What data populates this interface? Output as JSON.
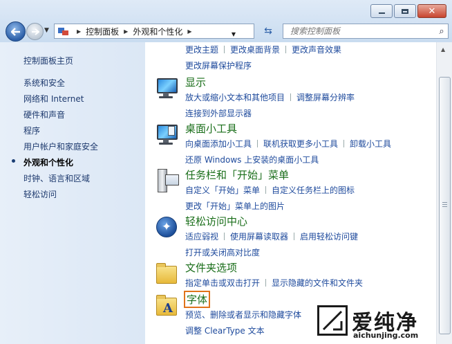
{
  "nav": {
    "breadcrumb": [
      "控制面板",
      "外观和个性化"
    ],
    "search_placeholder": "搜索控制面板"
  },
  "sidebar": {
    "home": "控制面板主页",
    "items": [
      {
        "label": "系统和安全"
      },
      {
        "label": "网络和 Internet"
      },
      {
        "label": "硬件和声音"
      },
      {
        "label": "程序"
      },
      {
        "label": "用户帐户和家庭安全"
      },
      {
        "label": "外观和个性化",
        "active": true
      },
      {
        "label": "时钟、语言和区域"
      },
      {
        "label": "轻松访问"
      }
    ]
  },
  "personalization_partial": {
    "links_row1": [
      "更改主题",
      "更改桌面背景",
      "更改声音效果"
    ],
    "links_row2": [
      "更改屏幕保护程序"
    ]
  },
  "categories": [
    {
      "title": "显示",
      "icon": "display-monitor-icon",
      "rows": [
        [
          "放大或缩小文本和其他项目",
          "调整屏幕分辨率"
        ],
        [
          "连接到外部显示器"
        ]
      ]
    },
    {
      "title": "桌面小工具",
      "icon": "gadgets-icon",
      "rows": [
        [
          "向桌面添加小工具",
          "联机获取更多小工具",
          "卸载小工具"
        ],
        [
          "还原 Windows 上安装的桌面小工具"
        ]
      ]
    },
    {
      "title": "任务栏和「开始」菜单",
      "icon": "taskbar-icon",
      "rows": [
        [
          "自定义「开始」菜单",
          "自定义任务栏上的图标"
        ],
        [
          "更改「开始」菜单上的图片"
        ]
      ]
    },
    {
      "title": "轻松访问中心",
      "icon": "ease-of-access-icon",
      "rows": [
        [
          "适应弱视",
          "使用屏幕读取器",
          "启用轻松访问键"
        ],
        [
          "打开或关闭高对比度"
        ]
      ]
    },
    {
      "title": "文件夹选项",
      "icon": "folder-options-icon",
      "rows": [
        [
          "指定单击或双击打开",
          "显示隐藏的文件和文件夹"
        ]
      ]
    },
    {
      "title": "字体",
      "icon": "fonts-icon",
      "highlighted": true,
      "rows": [
        [
          "预览、删除或者显示和隐藏字体"
        ],
        [
          "调整 ClearType 文本"
        ]
      ]
    }
  ],
  "watermark": {
    "name": "爱纯净",
    "url": "aichunjing.com"
  },
  "colors": {
    "category_title": "#1a6e1a",
    "link": "#1e4a9c",
    "highlight_box": "#e0731b"
  }
}
